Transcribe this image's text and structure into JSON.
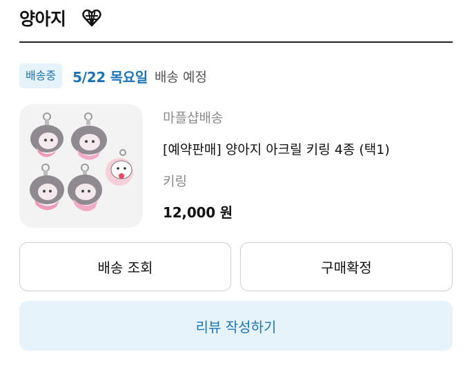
{
  "header": {
    "store_name": "양아지",
    "store_icon": "heart-globe-icon"
  },
  "order": {
    "status_badge": "배송중",
    "delivery_date": "5/22 목요일",
    "delivery_note": "배송 예정"
  },
  "product": {
    "seller": "마플샵배송",
    "title": "[예약판매] 양아지 아크릴 키링 4종 (택1)",
    "option": "키링",
    "price": "12,000 원",
    "image_desc": "keyring-product-photo"
  },
  "actions": {
    "track_label": "배송 조회",
    "confirm_label": "구매확정",
    "review_label": "리뷰 작성하기"
  },
  "colors": {
    "accent": "#1b74b8",
    "badge_bg": "#e6f3fb",
    "muted": "#8a8a8a"
  }
}
